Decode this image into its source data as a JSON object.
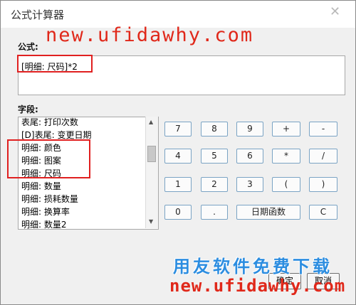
{
  "window": {
    "title": "公式计算器",
    "close_glyph": "✕"
  },
  "formula": {
    "label": "公式:",
    "value": "[明细: 尺码]*2"
  },
  "fields": {
    "label": "字段:",
    "items": [
      "表尾: 打印次数",
      "[D]表尾: 变更日期",
      "明细: 颜色",
      "明细: 图案",
      "明细: 尺码",
      "明细: 数量",
      "明细: 损耗数量",
      "明细: 换算率",
      "明细: 数量2"
    ]
  },
  "keypad": {
    "rows": [
      [
        "7",
        "8",
        "9",
        "+",
        "-"
      ],
      [
        "4",
        "5",
        "6",
        "*",
        "/"
      ],
      [
        "1",
        "2",
        "3",
        "(",
        ")"
      ],
      [
        "0",
        ".",
        "日期函数",
        "C"
      ]
    ]
  },
  "buttons": {
    "ok": "确定",
    "cancel": "取消"
  },
  "watermark": {
    "top": "new.ufidawhy.com",
    "chinese": "用友软件免费下载",
    "bottom": "new.ufidawhy.com"
  },
  "colors": {
    "highlight": "#e02020",
    "watermark_red": "#e0281a",
    "watermark_blue": "#2c8de0",
    "button_border": "#7aa3c4"
  }
}
